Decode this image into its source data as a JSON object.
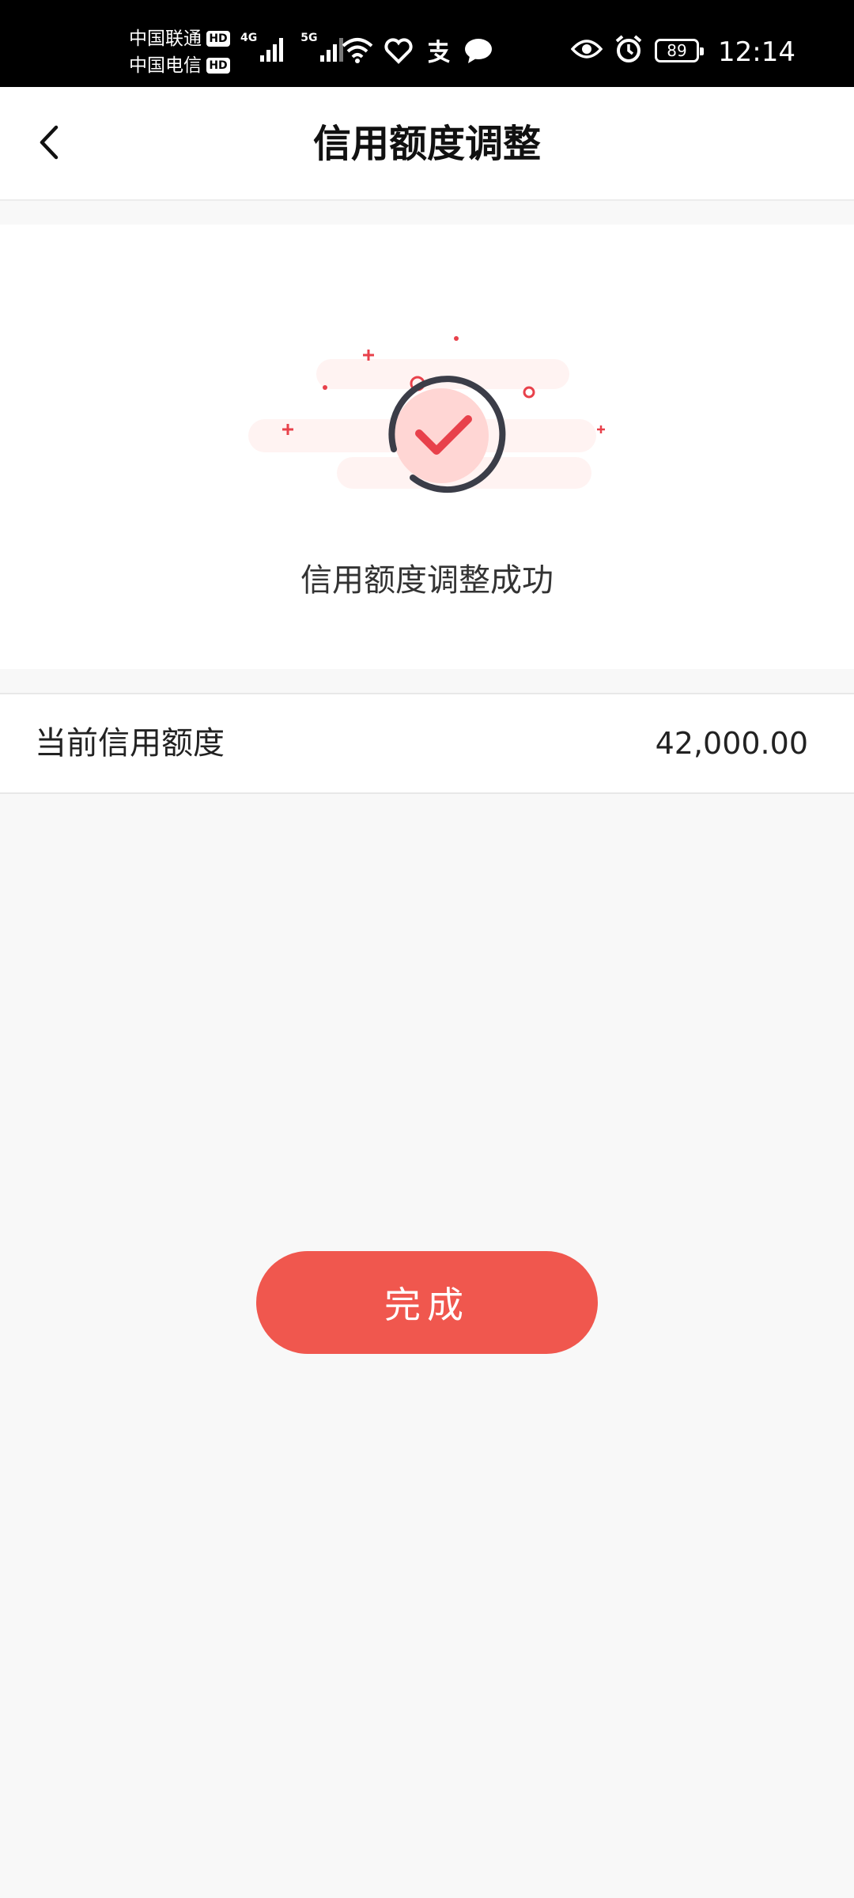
{
  "status_bar": {
    "carrier_1": "中国联通",
    "carrier_2": "中国电信",
    "hd_label": "HD",
    "network_1": "4G",
    "network_2": "5G",
    "battery": "89",
    "time": "12:14"
  },
  "nav": {
    "title": "信用额度调整"
  },
  "result": {
    "message": "信用额度调整成功"
  },
  "credit": {
    "label": "当前信用额度",
    "value": "42,000.00"
  },
  "actions": {
    "done_label": "完成"
  },
  "colors": {
    "accent": "#f0574e",
    "check": "#e8414b",
    "ring": "#3b3d48"
  }
}
